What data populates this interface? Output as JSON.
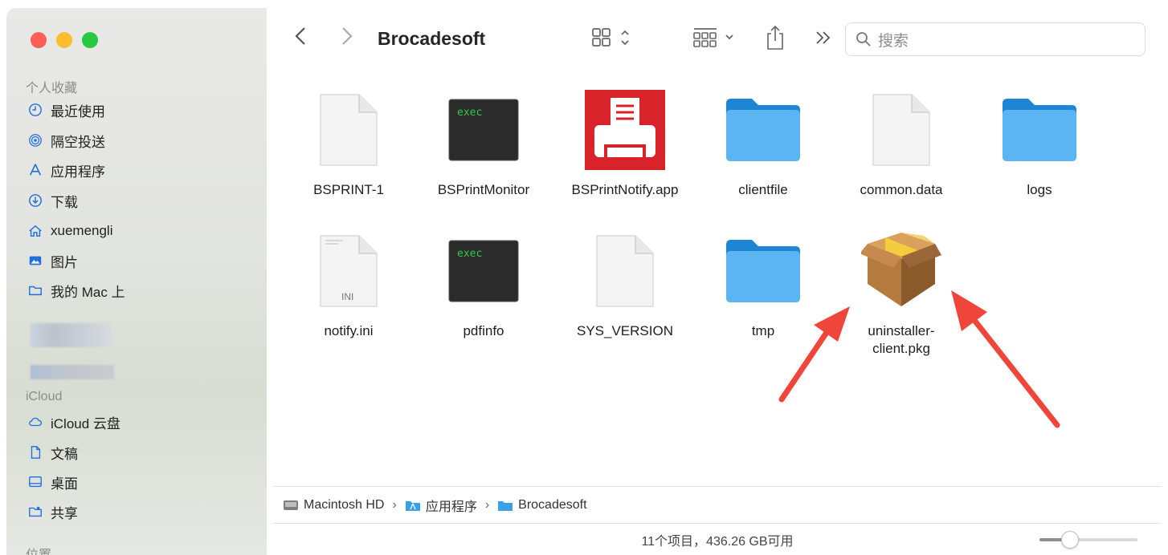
{
  "window": {
    "title": "Brocadesoft",
    "search_placeholder": "搜索"
  },
  "sidebar": {
    "favorites_header": "个人收藏",
    "favorites": [
      {
        "label": "最近使用",
        "icon": "clock-icon"
      },
      {
        "label": "隔空投送",
        "icon": "airdrop-icon"
      },
      {
        "label": "应用程序",
        "icon": "applications-icon"
      },
      {
        "label": "下载",
        "icon": "download-icon"
      },
      {
        "label": "xuemengli",
        "icon": "home-icon"
      },
      {
        "label": "图片",
        "icon": "pictures-icon"
      },
      {
        "label": "我的 Mac 上",
        "icon": "folder-icon"
      }
    ],
    "icloud_header": "iCloud",
    "icloud": [
      {
        "label": "iCloud 云盘",
        "icon": "cloud-icon"
      },
      {
        "label": "文稿",
        "icon": "document-icon"
      },
      {
        "label": "桌面",
        "icon": "desktop-icon"
      },
      {
        "label": "共享",
        "icon": "shared-folder-icon"
      }
    ],
    "locations_header": "位置"
  },
  "files": [
    {
      "name": "BSPRINT-1",
      "icon": "document-icon"
    },
    {
      "name": "BSPrintMonitor",
      "icon": "exec-icon"
    },
    {
      "name": "BSPrintNotify.app",
      "icon": "printer-app-icon"
    },
    {
      "name": "clientfile",
      "icon": "folder-icon"
    },
    {
      "name": "common.data",
      "icon": "document-icon"
    },
    {
      "name": "logs",
      "icon": "folder-icon"
    },
    {
      "name": "notify.ini",
      "icon": "ini-document-icon"
    },
    {
      "name": "pdfinfo",
      "icon": "exec-icon"
    },
    {
      "name": "SYS_VERSION",
      "icon": "document-icon"
    },
    {
      "name": "tmp",
      "icon": "folder-icon"
    },
    {
      "name": "uninstaller-\nclient.pkg",
      "icon": "package-icon"
    }
  ],
  "exec_text": "exec",
  "ini_text": "INI",
  "pathbar": {
    "items": [
      "Macintosh HD",
      "应用程序",
      "Brocadesoft"
    ]
  },
  "statusbar": {
    "text": "11个项目，436.26 GB可用",
    "zoom_fraction": 0.27
  },
  "colors": {
    "folder_blue": "#3aa0e8",
    "arrow_red": "#f0453a",
    "printer_red": "#d8232a"
  }
}
